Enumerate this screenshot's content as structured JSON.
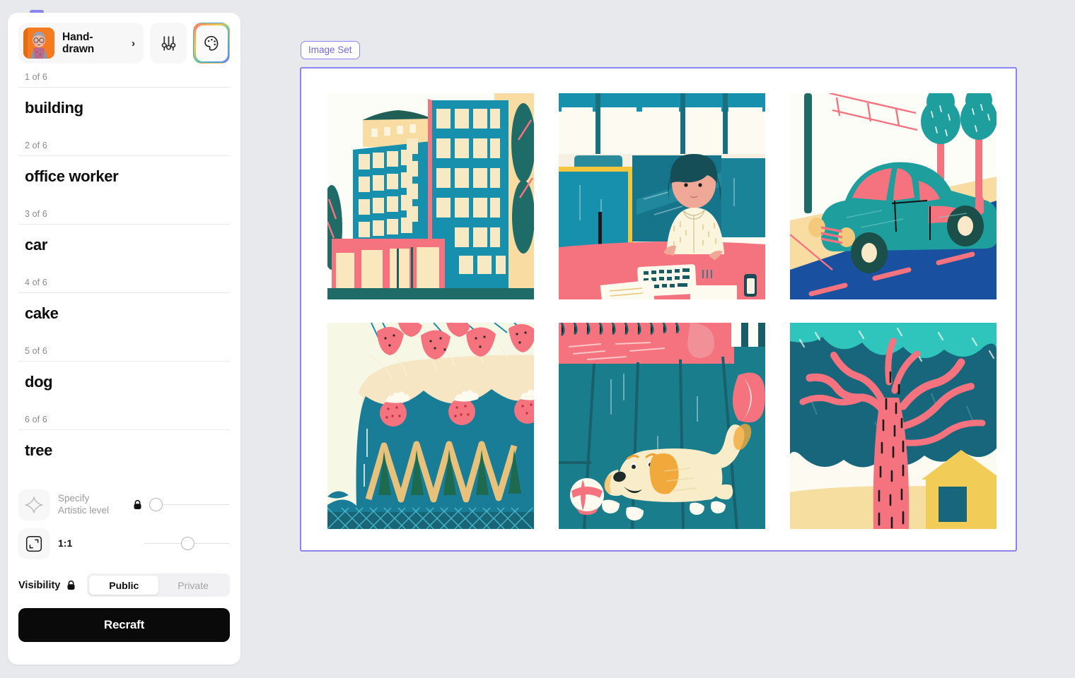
{
  "app": {
    "background_color": "#e8e9ed",
    "accent_color": "#8b85f0"
  },
  "sidebar": {
    "style_selector": {
      "name": "Hand-drawn",
      "thumbnail_alt": "portrait-illustration-thumbnail",
      "chevron": "›"
    },
    "settings_button_icon": "sliders-icon",
    "palette_button_icon": "palette-icon",
    "prompts": [
      {
        "count": "1 of 6",
        "text": "building"
      },
      {
        "count": "2 of 6",
        "text": "office worker"
      },
      {
        "count": "3 of 6",
        "text": "car"
      },
      {
        "count": "4 of 6",
        "text": "cake"
      },
      {
        "count": "5 of 6",
        "text": "dog"
      },
      {
        "count": "6 of 6",
        "text": "tree"
      }
    ],
    "artistic_level": {
      "icon": "sparkle-icon",
      "label_line1": "Specify",
      "label_line2": "Artistic level",
      "locked": true,
      "lock_icon": "lock-icon",
      "slider_value": 0
    },
    "aspect_ratio": {
      "icon": "crop-frame-icon",
      "label": "1:1",
      "slider_value": 45
    },
    "visibility": {
      "label": "Visibility",
      "lock_icon": "lock-icon",
      "options": [
        "Public",
        "Private"
      ],
      "selected": "Public"
    },
    "recraft_button": "Recraft"
  },
  "canvas": {
    "badge": "Image Set",
    "images": [
      {
        "id": "building",
        "alt": "hand-drawn-building-illustration"
      },
      {
        "id": "office-worker",
        "alt": "hand-drawn-office-worker-illustration"
      },
      {
        "id": "car",
        "alt": "hand-drawn-car-illustration"
      },
      {
        "id": "cake",
        "alt": "hand-drawn-cake-illustration"
      },
      {
        "id": "dog",
        "alt": "hand-drawn-dog-illustration"
      },
      {
        "id": "tree",
        "alt": "hand-drawn-tree-illustration"
      }
    ]
  }
}
